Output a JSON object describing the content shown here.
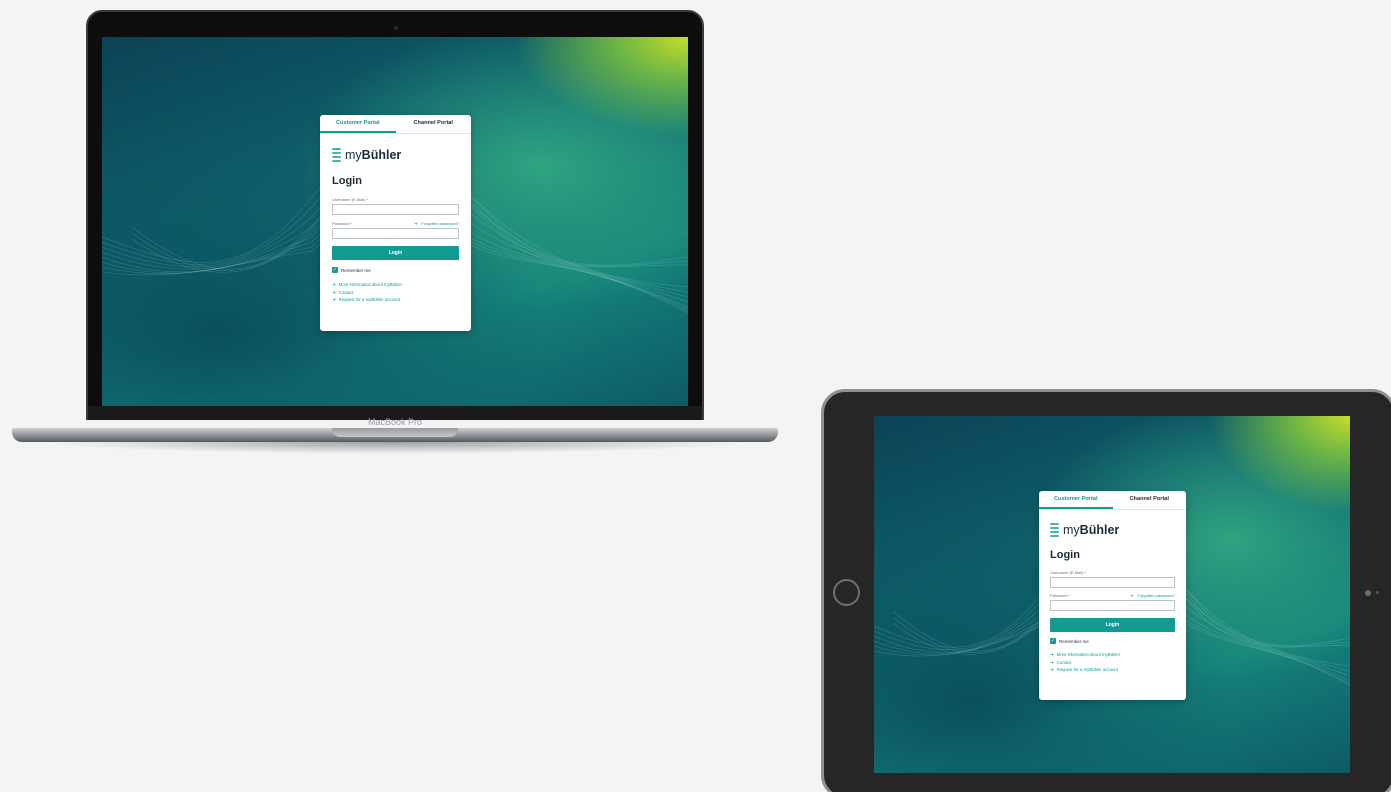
{
  "devices": {
    "laptop_label": "MacBook Pro"
  },
  "login_card": {
    "tabs": [
      {
        "label": "Customer Portal",
        "active": true
      },
      {
        "label": "Channel Portal",
        "active": false
      }
    ],
    "logo": {
      "prefix": "my",
      "brand": "Bühler",
      "icon": "buhler-logo-icon"
    },
    "title": "Login",
    "username_label": "Username (E-Mail) *",
    "password_label": "Password *",
    "forgot_password": "Forgotten password?",
    "login_button": "Login",
    "remember_me": "Remember me",
    "remember_checked": true,
    "links": [
      "More information about myBühler",
      "Contact",
      "Request for a myBühler account"
    ]
  },
  "colors": {
    "accent": "#139a91",
    "bg_dark": "#0b4256",
    "bg_highlight": "#c7dd2a",
    "page_bg": "#f4f4f4"
  }
}
